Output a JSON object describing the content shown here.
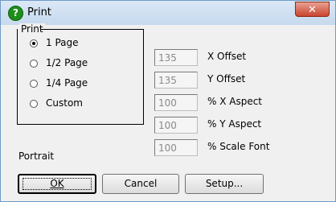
{
  "window": {
    "title": "Print",
    "close_symbol": "✕"
  },
  "group": {
    "label": "Print",
    "options": [
      {
        "label": "1 Page",
        "selected": true
      },
      {
        "label": "1/2 Page",
        "selected": false
      },
      {
        "label": "1/4 Page",
        "selected": false
      },
      {
        "label": "Custom",
        "selected": false
      }
    ]
  },
  "fields": [
    {
      "value": "135",
      "label": "X Offset"
    },
    {
      "value": "135",
      "label": "Y Offset"
    },
    {
      "value": "100",
      "label": "% X Aspect"
    },
    {
      "value": "100",
      "label": "% Y Aspect"
    },
    {
      "value": "100",
      "label": "% Scale Font"
    }
  ],
  "orientation": "Portrait",
  "buttons": {
    "ok": "OK",
    "cancel": "Cancel",
    "setup": "Setup..."
  }
}
